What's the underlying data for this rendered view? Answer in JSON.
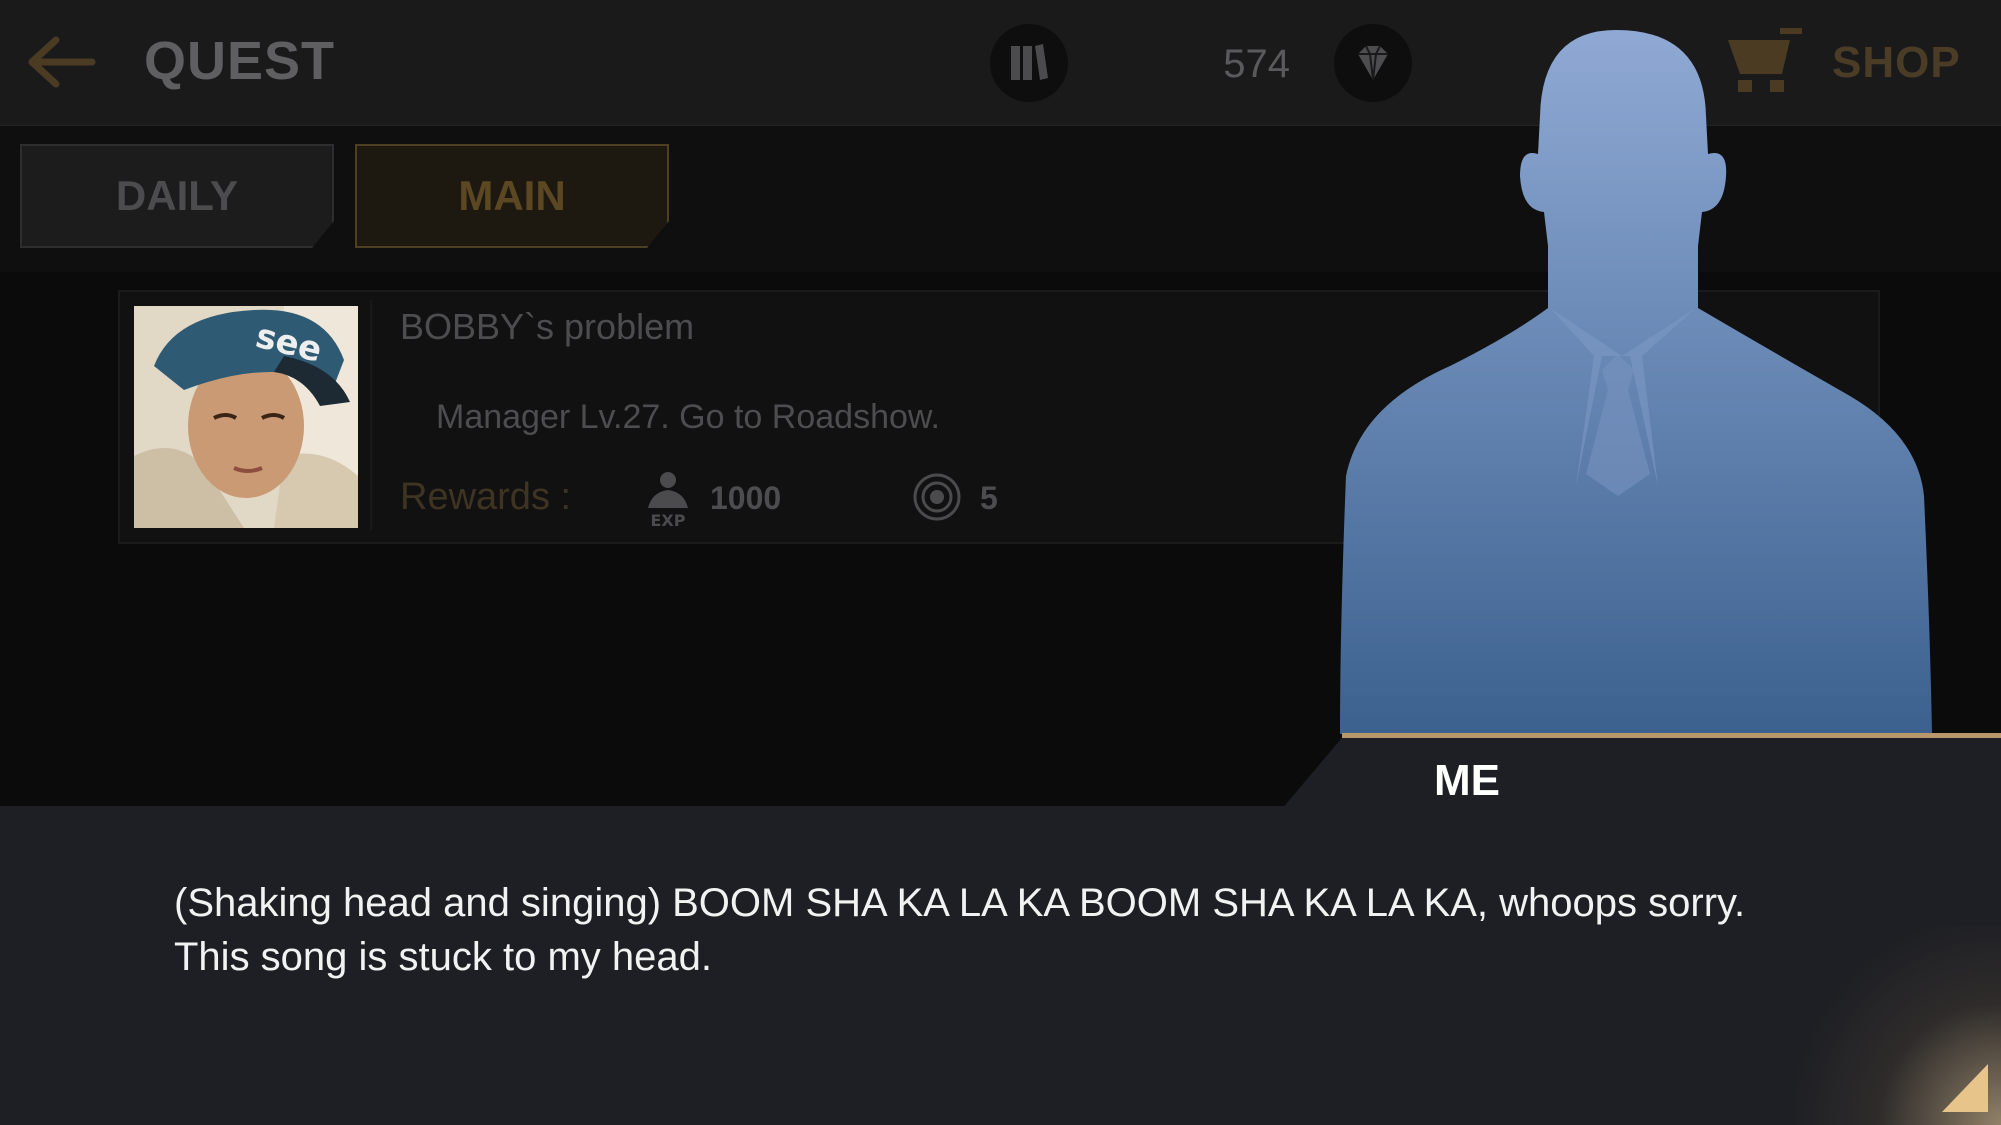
{
  "header": {
    "title": "QUEST",
    "gem_count": "574",
    "shop_label": "SHOP",
    "icons": [
      "back-arrow-icon",
      "book-icon",
      "gem-icon",
      "cart-icon"
    ]
  },
  "tabs": [
    {
      "label": "DAILY",
      "active": false
    },
    {
      "label": "MAIN",
      "active": true
    }
  ],
  "quest": {
    "name": "BOBBY`s problem",
    "description": "Manager Lv.27. Go to Roadshow.",
    "rewards_label": "Rewards :",
    "rewards": [
      {
        "icon": "exp-icon",
        "value": "1000"
      },
      {
        "icon": "medal-icon",
        "value": "5"
      }
    ]
  },
  "dialogue": {
    "speaker": "ME",
    "text": "(Shaking head and singing) BOOM SHA KA LA KA BOOM SHA KA LA KA, whoops sorry. This song is stuck to my head."
  },
  "colors": {
    "accent_gold": "#b8976a",
    "silhouette_top": "#8fa9d4",
    "silhouette_bottom": "#3c618f"
  }
}
